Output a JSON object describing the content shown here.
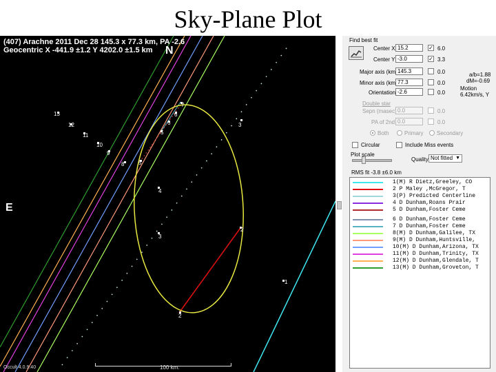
{
  "slide_title": "Sky-Plane Plot",
  "plot": {
    "header_line1": "(407) Arachne  2011 Dec 28   145.3 x 77.3 km, PA -2.6",
    "header_line2": "Geocentric  X  -441.9 ±1.2  Y 4202.0 ±1.5 km",
    "north_label": "N",
    "east_label": "E",
    "version": "Occult 4.0.9.40",
    "scale_label": "100 km.",
    "chord_labels": [
      "13",
      "12",
      "11",
      "10",
      "9",
      "8",
      "5",
      "7",
      "6",
      "6",
      "5",
      "3",
      "4",
      "3",
      "2",
      "2",
      "1"
    ]
  },
  "panel": {
    "find_best_fit": "Find best fit",
    "center_x_label": "Center X",
    "center_x_value": "15.2",
    "center_x_sigma": "6.0",
    "center_y_label": "Center Y",
    "center_y_value": "-3.0",
    "center_y_sigma": "3.3",
    "major_axis_label": "Major axis (km)",
    "major_axis_value": "145.3",
    "major_axis_sigma": "0.0",
    "minor_axis_label": "Minor axis (km)",
    "minor_axis_value": "77.3",
    "minor_axis_sigma": "0.0",
    "orientation_label": "Orientation",
    "orientation_value": "-2.6",
    "orientation_sigma": "0.0",
    "ratio_text": "a/b=1.88",
    "dm_text": "dM=-0.69",
    "motion_label": "Motion",
    "motion_value": "6.42km/s, Y",
    "double_star": "Double star",
    "sepn_label": "Sepn (masec)",
    "sepn_value": "0.0",
    "sepn_sigma": "0.0",
    "pa_label": "PA of 2nd",
    "pa_value": "0.0",
    "pa_sigma": "0.0",
    "radio_both": "Both",
    "radio_primary": "Primary",
    "radio_secondary": "Secondary",
    "circular_label": "Circular",
    "include_miss_label": "Include Miss events",
    "plot_scale_label": "Plot scale",
    "quality_label": "Quality",
    "quality_value": "Not fitted",
    "rms_text": "RMS fit -3.8 ±6.0 km"
  },
  "legend": [
    {
      "text": "1(M)  R Dietz,Greeley, CO",
      "color": "#3ee6ee"
    },
    {
      "text": "2   P Maley ,McGregor, T",
      "color": "#e01010"
    },
    {
      "text": "3(P) Predicted Centerline",
      "color": "#9fd9df"
    },
    {
      "text": "4   D Dunham,Roans Prair",
      "color": "#8a2be2"
    },
    {
      "text": "5   D Dunham,Foster Ceme",
      "color": "#b02a2a"
    },
    {
      "text": "6   D Dunham,Foster Ceme",
      "color": "#7f8fb0"
    },
    {
      "text": "7   D Dunham,Foster Ceme",
      "color": "#58b4c4"
    },
    {
      "text": "8(M) D Dunham,Galilee, TX",
      "color": "#a8ff60"
    },
    {
      "text": "9(M) D Dunham,Huntsville,",
      "color": "#ff9a7a"
    },
    {
      "text": "10(M) D Dunham,Arizona, TX",
      "color": "#6f9fff"
    },
    {
      "text": "11(M) D Dunham,Trinity, TX",
      "color": "#e040e0"
    },
    {
      "text": "12(M) D Dunham,Glendale, T",
      "color": "#ffb050"
    },
    {
      "text": "13(M) D Dunham,Groveton, T",
      "color": "#2e9e2e"
    }
  ]
}
